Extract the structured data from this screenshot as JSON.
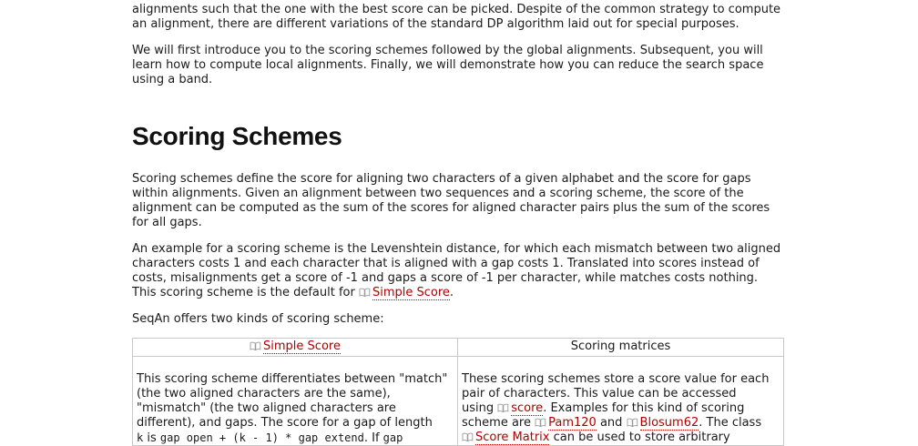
{
  "intro_partial": {
    "line1": "alignments such that the one with the best score can be picked. Despite of the common strategy to compute",
    "line2": "an alignment, there are different variations of the standard DP algorithm laid out for special purposes."
  },
  "intro2": {
    "line1": "We will first introduce you to the scoring schemes followed by the global alignments. Subsequent, you will",
    "line2": "learn how to compute local alignments. Finally, we will demonstrate how you can reduce the search space",
    "line3": "using a band."
  },
  "section_title": "Scoring Schemes",
  "para1": {
    "line1": "Scoring schemes define the score for aligning two characters of a given alphabet and the score for gaps",
    "line2": "within alignments. Given an alignment between two sequences and a scoring scheme, the score of the",
    "line3": "alignment can be computed as the sum of the scores for aligned character pairs plus the sum of the scores",
    "line4": "for all gaps."
  },
  "para2": {
    "line1": "An example for a scoring scheme is the Levenshtein distance, for which each mismatch between two aligned",
    "line2": "characters costs 1 and each character that is aligned with a gap costs 1. Translated into scores instead of",
    "line3": "costs, misalignments get a score of -1 and gaps a score of -1 per character, while matches costs nothing.",
    "line4_pre": "This scoring scheme is the default for ",
    "line4_link": "Simple Score",
    "line4_post": "."
  },
  "para3": "SeqAn offers two kinds of scoring scheme:",
  "table": {
    "header_left_link": "Simple Score",
    "header_right": "Scoring matrices",
    "left": {
      "line1": "This scoring scheme differentiates between \"match\"",
      "line2": "(the two aligned characters are the same),",
      "line3": "\"mismatch\" (the two aligned characters are",
      "line4": "different), and gaps. The score for a gap of length",
      "line5_code1": "k",
      "line5_text1": " is ",
      "line5_code2": "gap open + (k - 1) * gap extend",
      "line5_text2": ". If ",
      "line5_code3": "gap"
    },
    "right": {
      "line1": "These scoring schemes store a score value for each",
      "line2": "pair of characters. This value can be accessed",
      "line3_pre": "using ",
      "line3_link": "score",
      "line3_post": ". Examples for this kind of scoring",
      "line4_pre": "scheme are ",
      "line4_link1": "Pam120",
      "line4_mid": " and ",
      "line4_link2": "Blosum62",
      "line4_post": ". The class",
      "line5_link": "Score Matrix",
      "line5_post": " can be used to store arbitrary"
    }
  },
  "colors": {
    "link": "#b00000",
    "text": "#1a1a1a",
    "border": "#c8c8c8"
  },
  "icons": {
    "doc_link": "book-icon"
  }
}
